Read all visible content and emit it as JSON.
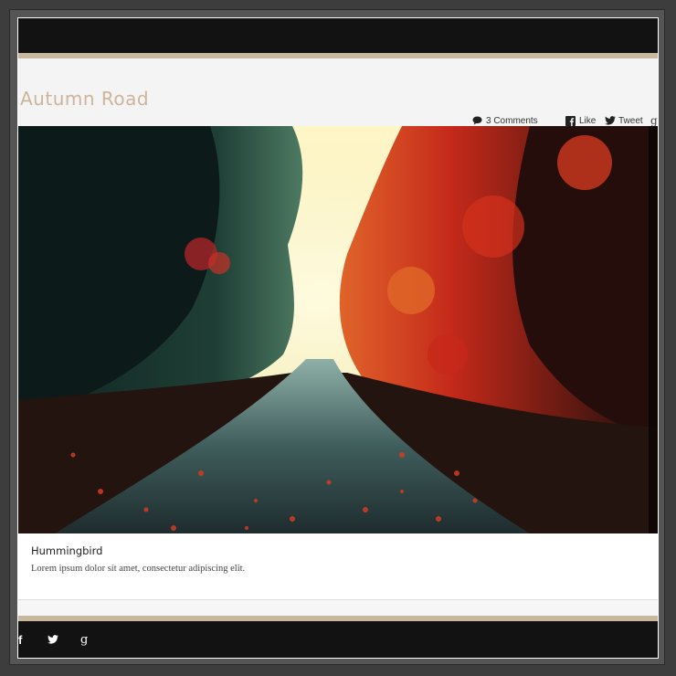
{
  "post": {
    "title": "Autumn Road",
    "comments": "3 Comments",
    "like_label": "Like",
    "tweet_label": "Tweet",
    "gplus_icon": "g"
  },
  "caption": {
    "title": "Hummingbird",
    "text": "Lorem ipsum dolor sit amet, consectetur adipiscing elit."
  },
  "footer": {
    "facebook_icon": "f",
    "twitter_icon": "twitter-bird",
    "googleplus_icon": "g"
  },
  "colors": {
    "accent": "#cdb49a",
    "bar": "#121212",
    "rule": "#c9b8a0"
  }
}
